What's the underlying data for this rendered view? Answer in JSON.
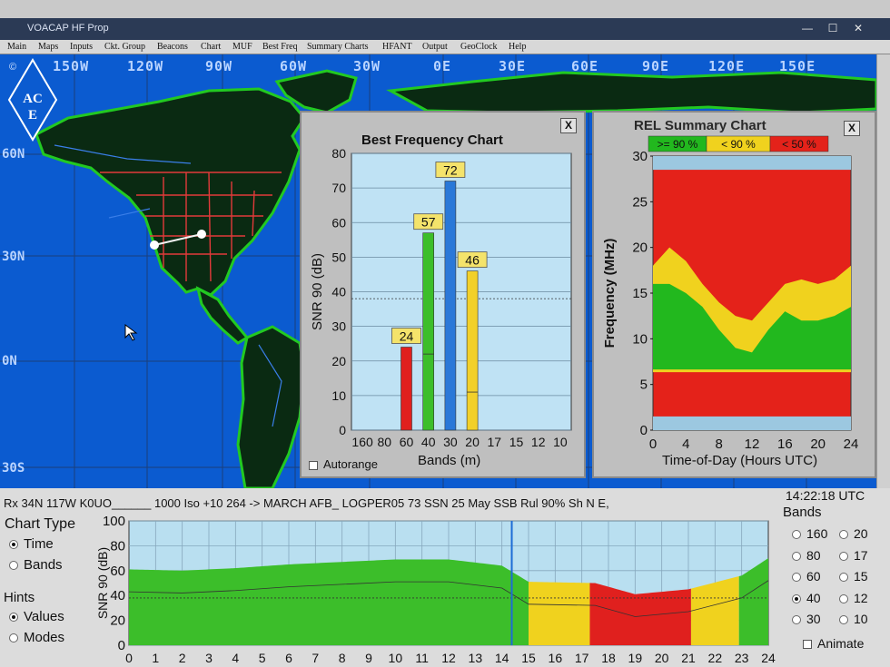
{
  "window": {
    "title": "VOACAP HF Prop"
  },
  "menu": [
    "Main",
    "Maps",
    "Inputs",
    "Ckt. Group",
    "Beacons",
    "Chart",
    "MUF",
    "Best Freq",
    "Summary Charts",
    "HFANT",
    "Output",
    "GeoClock",
    "Help"
  ],
  "map": {
    "logo": "ACE",
    "copyright": "©",
    "lon_labels": [
      "150W",
      "120W",
      "90W",
      "60W",
      "30W",
      "0E",
      "30E",
      "60E",
      "90E",
      "120E",
      "150E"
    ],
    "lat_labels": [
      "60N",
      "30N",
      "0N",
      "30S"
    ],
    "colors": {
      "ocean": "#0b5bd0",
      "land": "#0a2a12",
      "coast": "#22c922",
      "borders": "#e23a3a",
      "rivers": "#3a7ee8"
    }
  },
  "best_freq": {
    "close_label": "X",
    "autorange_label": "Autorange",
    "chart_data": {
      "type": "bar",
      "title": "Best Frequency Chart",
      "xlabel": "Bands (m)",
      "ylabel": "SNR 90 (dB)",
      "categories": [
        "160",
        "80",
        "60",
        "40",
        "30",
        "20",
        "17",
        "15",
        "12",
        "10"
      ],
      "values": [
        null,
        null,
        24,
        57,
        72,
        46,
        null,
        null,
        null,
        null
      ],
      "colors": [
        null,
        null,
        "#e0201e",
        "#3cbe2a",
        "#2a78d8",
        "#f2d02a",
        null,
        null,
        null,
        null
      ],
      "inner_values": [
        null,
        null,
        null,
        22,
        null,
        11,
        null,
        null,
        null,
        null
      ],
      "ylim": [
        0,
        80
      ],
      "yticks": [
        0,
        10,
        20,
        30,
        40,
        50,
        60,
        70,
        80
      ],
      "grid": true
    }
  },
  "rel_summary": {
    "close_label": "X",
    "chart_data": {
      "type": "area",
      "title": "REL Summary Chart",
      "xlabel": "Time-of-Day (Hours UTC)",
      "ylabel": "Frequency (MHz)",
      "legend": [
        {
          "label": ">= 90 %",
          "color": "#22b81e"
        },
        {
          "label": "< 90 %",
          "color": "#f0d21e"
        },
        {
          "label": "< 50 %",
          "color": "#e4221a"
        }
      ],
      "xlim": [
        0,
        24
      ],
      "ylim": [
        0,
        30
      ],
      "xticks": [
        0,
        4,
        8,
        12,
        16,
        20,
        24
      ],
      "yticks": [
        0,
        5,
        10,
        15,
        20,
        25,
        30
      ],
      "hours": [
        0,
        2,
        4,
        6,
        8,
        10,
        12,
        14,
        16,
        18,
        20,
        22,
        24
      ],
      "green_top_mhz": [
        16,
        16,
        15,
        13.5,
        11,
        9,
        8.5,
        11,
        13,
        12,
        12,
        12.5,
        13.5
      ],
      "yellow_top_mhz": [
        18,
        20,
        18.5,
        16,
        14,
        12.5,
        12,
        14,
        16,
        16.5,
        16,
        16.5,
        18
      ]
    }
  },
  "status": {
    "circuit_line": "Rx 34N  117W     K0UO______   1000 Iso +10 264 -> MARCH AFB_ LOGPER05 73 SSN 25 May SSB Rul 90% Sh N E,",
    "clock": "14:22:18 UTC",
    "chart_type_label": "Chart Type",
    "chart_type_options": [
      "Time",
      "Bands"
    ],
    "chart_type_selected": "Time",
    "hints_label": "Hints",
    "hints_options": [
      "Values",
      "Modes"
    ],
    "hints_selected": "Values",
    "bands_label": "Bands",
    "bands_left": [
      "160",
      "80",
      "60",
      "40",
      "30"
    ],
    "bands_right": [
      "20",
      "17",
      "15",
      "12",
      "10"
    ],
    "band_selected": "40",
    "animate_label": "Animate",
    "chart_data": {
      "type": "area",
      "ylabel": "SNR 90 (dB)",
      "xlim": [
        0,
        24
      ],
      "ylim": [
        0,
        100
      ],
      "xticks": [
        0,
        1,
        2,
        3,
        4,
        5,
        6,
        7,
        8,
        9,
        10,
        11,
        12,
        13,
        14,
        15,
        16,
        17,
        18,
        19,
        20,
        21,
        22,
        23,
        24
      ],
      "yticks": [
        0,
        20,
        40,
        60,
        80,
        100
      ],
      "hours": [
        0,
        2,
        4,
        6,
        8,
        10,
        12,
        14,
        15,
        17.5,
        19,
        21,
        23,
        24
      ],
      "snr": [
        61,
        60,
        62,
        65,
        67,
        69,
        69,
        64,
        51,
        50,
        41,
        45,
        56,
        70
      ],
      "segments": [
        {
          "from": 0,
          "to": 15,
          "color": "#3cbe2a"
        },
        {
          "from": 15,
          "to": 17.3,
          "color": "#f0d21e"
        },
        {
          "from": 17.3,
          "to": 21.1,
          "color": "#e0201e"
        },
        {
          "from": 21.1,
          "to": 22.9,
          "color": "#f0d21e"
        },
        {
          "from": 22.9,
          "to": 24,
          "color": "#3cbe2a"
        }
      ],
      "marker_hour": 14.37
    }
  }
}
